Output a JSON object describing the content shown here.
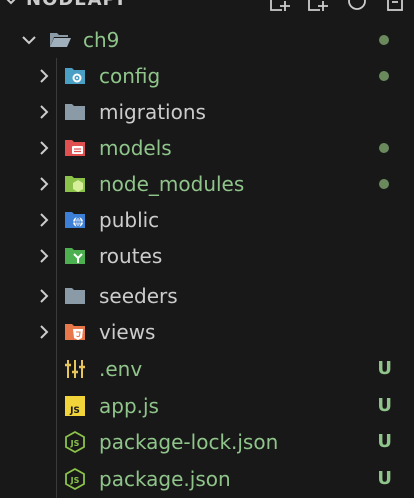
{
  "explorer": {
    "section_title": "NODEAPI",
    "actions": [
      "new-file-icon",
      "new-folder-icon",
      "refresh-icon",
      "collapse-all-icon"
    ]
  },
  "tree": {
    "root": {
      "label": "ch9",
      "icon": "folder-open-icon",
      "status": "modified-dot"
    },
    "folders": [
      {
        "label": "config",
        "icon": "config-folder-icon",
        "status": "dot",
        "modified": true
      },
      {
        "label": "migrations",
        "icon": "folder-icon",
        "status": "",
        "modified": false
      },
      {
        "label": "models",
        "icon": "models-folder-icon",
        "status": "dot",
        "modified": true
      },
      {
        "label": "node_modules",
        "icon": "node-modules-folder-icon",
        "status": "dot",
        "modified": true
      },
      {
        "label": "public",
        "icon": "public-folder-icon",
        "status": "",
        "modified": false
      },
      {
        "label": "routes",
        "icon": "routes-folder-icon",
        "status": "",
        "modified": false
      },
      {
        "label": "seeders",
        "icon": "folder-icon",
        "status": "",
        "modified": false
      },
      {
        "label": "views",
        "icon": "views-folder-icon",
        "status": "",
        "modified": false
      }
    ],
    "files": [
      {
        "label": ".env",
        "icon": "env-file-icon",
        "status": "U"
      },
      {
        "label": "app.js",
        "icon": "js-file-icon",
        "status": "U"
      },
      {
        "label": "package-lock.json",
        "icon": "nodejs-file-icon",
        "status": "U"
      },
      {
        "label": "package.json",
        "icon": "nodejs-file-icon",
        "status": "U"
      }
    ]
  },
  "colors": {
    "background": "#181818",
    "untracked_text": "#8fc48a",
    "default_text": "#cccccc",
    "modified_dot": "#6a8a5e"
  }
}
